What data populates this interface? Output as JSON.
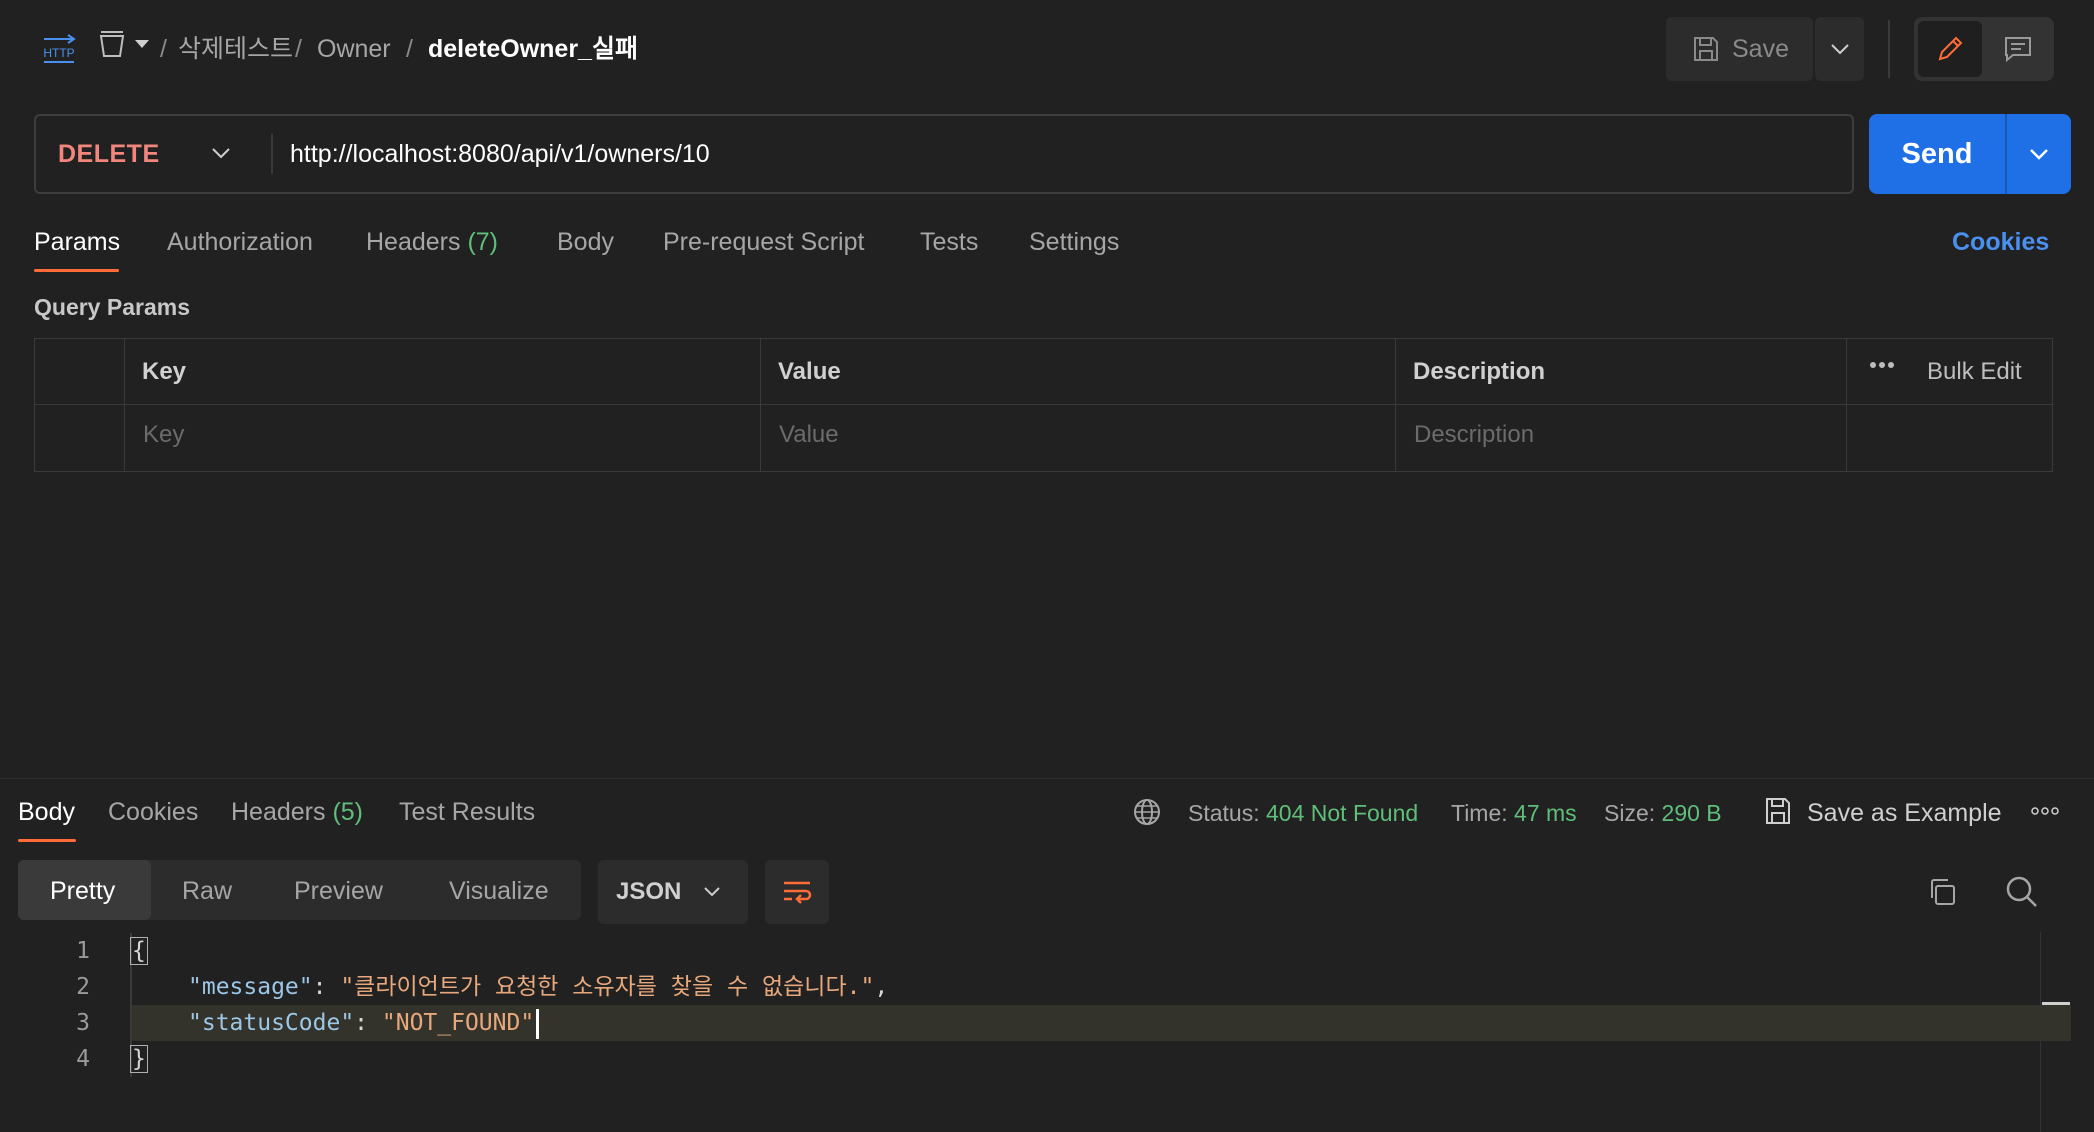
{
  "header": {
    "protocol_badge": "HTTP",
    "breadcrumb": [
      "삭제테스트",
      "Owner",
      "deleteOwner_실패"
    ],
    "separator": "/",
    "save_label": "Save"
  },
  "request": {
    "method": "DELETE",
    "url": "http://localhost:8080/api/v1/owners/10",
    "send_label": "Send"
  },
  "tabs": {
    "params": "Params",
    "authorization": "Authorization",
    "headers": "Headers",
    "headers_count": "(7)",
    "body": "Body",
    "prerequest": "Pre-request Script",
    "tests": "Tests",
    "settings": "Settings",
    "cookies": "Cookies"
  },
  "query_params": {
    "title": "Query Params",
    "columns": [
      "Key",
      "Value",
      "Description"
    ],
    "placeholders": [
      "Key",
      "Value",
      "Description"
    ],
    "bulk_edit": "Bulk Edit"
  },
  "response": {
    "tabs": {
      "body": "Body",
      "cookies": "Cookies",
      "headers": "Headers",
      "headers_count": "(5)",
      "test_results": "Test Results"
    },
    "status_label": "Status:",
    "status_value": "404 Not Found",
    "time_label": "Time:",
    "time_value": "47 ms",
    "size_label": "Size:",
    "size_value": "290 B",
    "save_example": "Save as Example",
    "formats": [
      "Pretty",
      "Raw",
      "Preview",
      "Visualize"
    ],
    "selected_format": "Pretty",
    "language": "JSON",
    "line_numbers": [
      "1",
      "2",
      "3",
      "4"
    ],
    "code": {
      "open_brace": "{",
      "close_brace": "}",
      "line2_key": "\"message\"",
      "line2_value": "\"클라이언트가 요청한 소유자를 찾을 수 없습니다.\"",
      "line3_key": "\"statusCode\"",
      "line3_value": "\"NOT_FOUND\""
    }
  },
  "colors": {
    "method": "#f2867c",
    "accent_tab": "#ff6c37",
    "send": "#1f6fe6",
    "status_ok_value": "#5fbf7a",
    "cookies_link": "#4a90f0"
  },
  "icons": [
    "http-icon",
    "collection-icon",
    "save-icon",
    "chevron-down-icon",
    "pencil-icon",
    "comment-icon",
    "more-icon",
    "globe-icon",
    "save-example-icon",
    "wrap-icon",
    "copy-icon",
    "search-icon"
  ]
}
